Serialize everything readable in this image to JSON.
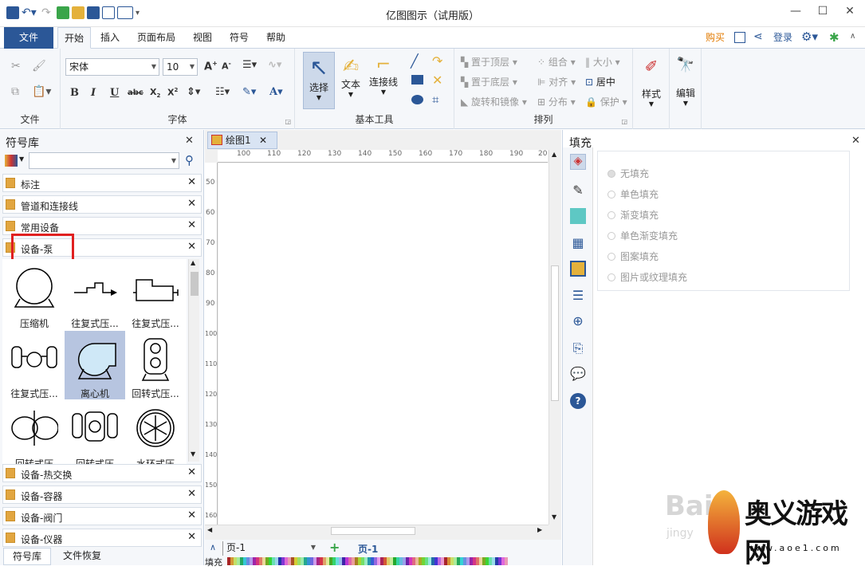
{
  "app": {
    "title": "亿图图示（试用版）"
  },
  "menu": {
    "file": "文件",
    "tabs": [
      "开始",
      "插入",
      "页面布局",
      "视图",
      "符号",
      "帮助"
    ],
    "right": {
      "buy": "购买",
      "login": "登录"
    }
  },
  "ribbon": {
    "groups": {
      "file": "文件",
      "font": "字体",
      "basic": "基本工具",
      "arrange": "排列"
    },
    "font_name": "宋体",
    "font_size": "10",
    "select": "选择",
    "text": "文本",
    "connector": "连接线",
    "arrange": {
      "top": "置于顶层",
      "bottom": "置于底层",
      "rotate": "旋转和镜像",
      "group": "组合",
      "align": "对齐",
      "distribute": "分布",
      "size": "大小",
      "center": "居中",
      "protect": "保护"
    },
    "style": "样式",
    "edit": "编辑"
  },
  "library": {
    "title": "符号库",
    "categories_top": [
      "标注",
      "管道和连接线",
      "常用设备",
      "设备-泵"
    ],
    "shapes": [
      "压缩机",
      "往复式压...",
      "往复式压...",
      "往复式压...",
      "离心机",
      "回转式压...",
      "回转式压",
      "回转式压",
      "水环式压"
    ],
    "categories_bottom": [
      "设备-热交换",
      "设备-容器",
      "设备-阀门",
      "设备-仪器"
    ],
    "bottom_tabs": [
      "符号库",
      "文件恢复"
    ]
  },
  "canvas": {
    "doc_tab": "绘图1",
    "hruler": [
      "100",
      "110",
      "120",
      "130",
      "140",
      "150",
      "160",
      "170",
      "180",
      "190",
      "20"
    ],
    "vruler": [
      "50",
      "60",
      "70",
      "80",
      "90",
      "100",
      "110",
      "120",
      "130",
      "140",
      "150",
      "160"
    ],
    "page_select": "页-1",
    "page_tab": "页-1",
    "fill_label": "填充"
  },
  "fill": {
    "title": "填充",
    "options": [
      "无填充",
      "单色填充",
      "渐变填充",
      "单色渐变填充",
      "图案填充",
      "图片或纹理填充"
    ]
  },
  "colors": {
    "accent": "#2b5797",
    "highlight": "#e02020",
    "selection": "#b7c5e0"
  },
  "watermark": {
    "brand": "奥义游戏网",
    "url": "www.aoe1.com",
    "baidu": "Bai",
    "jingy": "jingy"
  }
}
